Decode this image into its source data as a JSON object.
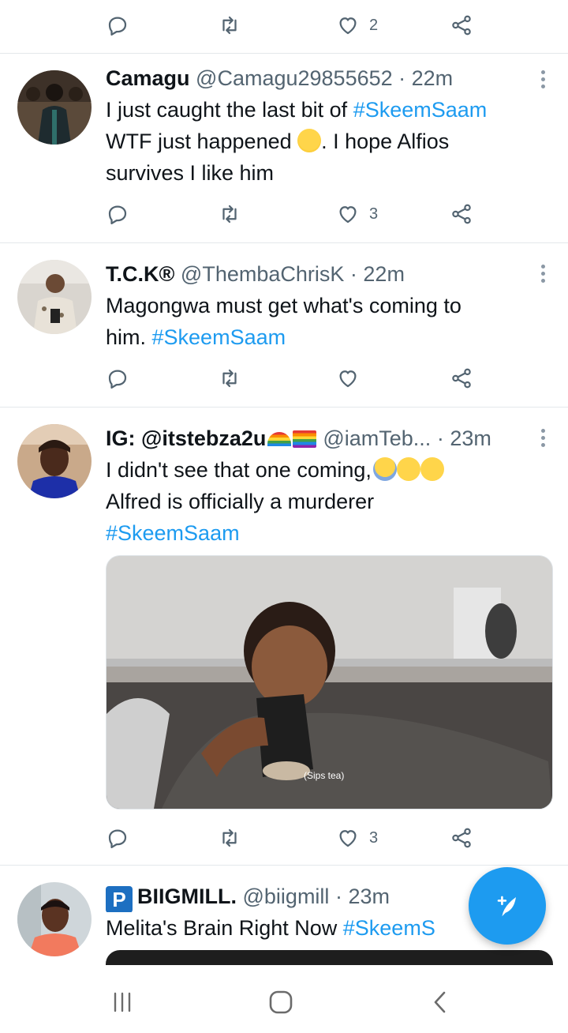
{
  "tweets": [
    {
      "name": "",
      "handle": "",
      "time": "",
      "likes": "2"
    },
    {
      "name": "Camagu",
      "handle": "@Camagu29855652",
      "time": "· 22m",
      "text_pre": "I just caught the last bit of ",
      "tag1": "#SkeemSaam",
      "line2_pre": "WTF just happened ",
      "line2_post": ". I hope Alfios",
      "line3": "survives I like him",
      "likes": "3"
    },
    {
      "name": "T.C.K",
      "name_symbol": "®",
      "handle": "@ThembaChrisK",
      "time": "· 22m",
      "line1": "Magongwa must get what's coming to",
      "line2_pre": "him. ",
      "tag1": "#SkeemSaam",
      "likes": ""
    },
    {
      "name": "IG: @itstebza2u",
      "handle": "@iamTeb...",
      "time": "· 23m",
      "line1": "I didn't see that one coming,",
      "line2": "Alfred is officially a murderer",
      "tag1": "#SkeemSaam",
      "media_caption": "(Sips tea)",
      "likes": "3"
    },
    {
      "badge": "P",
      "name": "BIIGMILL.",
      "handle": "@biigmill",
      "time": "· 23m",
      "line1": "Melita's Brain Right Now ",
      "tag1": "#SkeemS"
    }
  ],
  "icons": {
    "reply": "reply-icon",
    "retweet": "retweet-icon",
    "like": "heart-icon",
    "share": "share-icon",
    "more": "more-vertical-icon",
    "compose": "compose-tweet-icon"
  },
  "colors": {
    "accent": "#1d9bf0",
    "text": "#0f1419",
    "muted": "#536471"
  }
}
